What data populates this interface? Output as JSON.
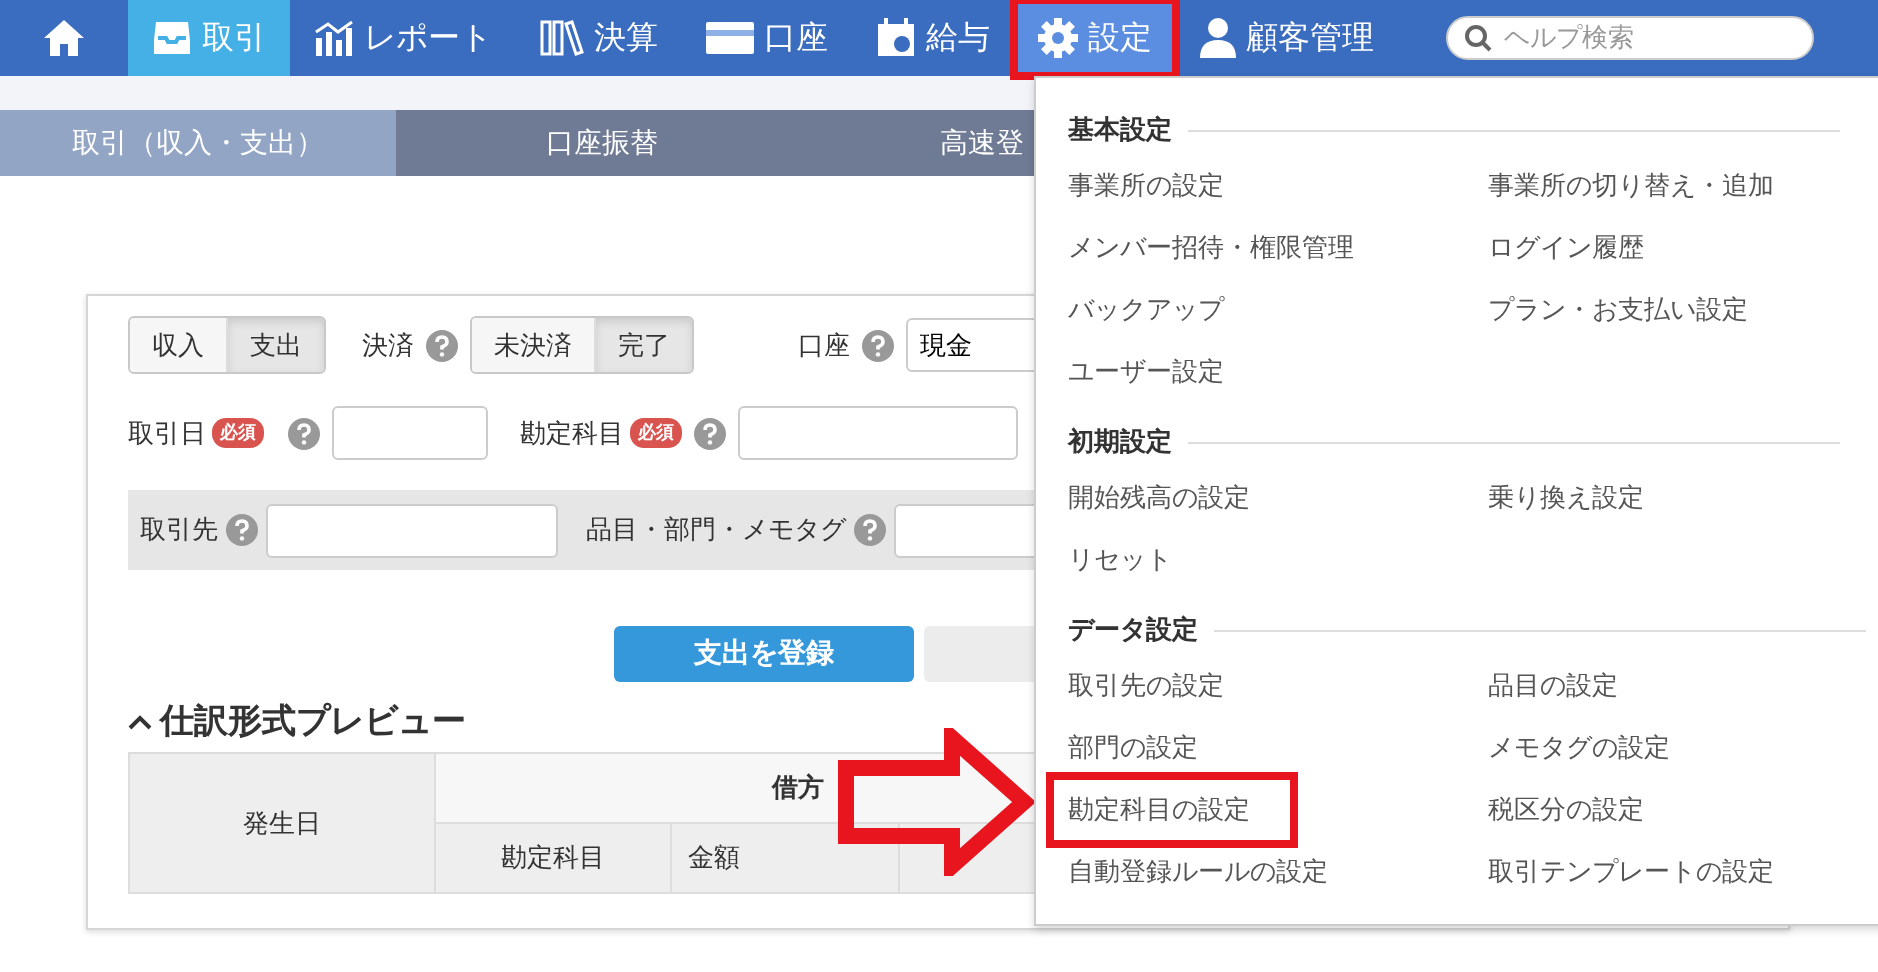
{
  "nav": {
    "items": [
      {
        "label": "取引",
        "selected": true,
        "highlighted": false
      },
      {
        "label": "レポート",
        "selected": false,
        "highlighted": false
      },
      {
        "label": "決算",
        "selected": false,
        "highlighted": false
      },
      {
        "label": "口座",
        "selected": false,
        "highlighted": false
      },
      {
        "label": "給与",
        "selected": false,
        "highlighted": false
      },
      {
        "label": "設定",
        "selected": false,
        "highlighted": true,
        "open": true
      },
      {
        "label": "顧客管理",
        "selected": false,
        "highlighted": false
      }
    ],
    "search": {
      "placeholder": "ヘルプ検索"
    }
  },
  "subtabs": [
    {
      "label": "取引（収入・支出）",
      "selected": true
    },
    {
      "label": "口座振替",
      "selected": false
    },
    {
      "label": "高速登",
      "selected": false
    }
  ],
  "form": {
    "type_toggle": [
      {
        "label": "収入",
        "selected": false
      },
      {
        "label": "支出",
        "selected": true
      }
    ],
    "settlement": {
      "label": "決済",
      "options": [
        {
          "label": "未決済",
          "selected": false
        },
        {
          "label": "完了",
          "selected": true
        }
      ]
    },
    "account": {
      "label": "口座",
      "value": "現金"
    },
    "date": {
      "label": "取引日",
      "badge": "必須"
    },
    "category": {
      "label": "勘定科目",
      "badge": "必須"
    },
    "partner": {
      "label": "取引先"
    },
    "tags": {
      "label": "品目・部門・メモタグ"
    },
    "submit_button": "支出を登録",
    "preview": {
      "title": "仕訳形式プレビュー",
      "expanded": true,
      "date_column": "発生日",
      "debit_column": "借方",
      "debit_subcolumns": [
        "勘定科目",
        "金額"
      ]
    }
  },
  "settings_menu": {
    "sections": [
      {
        "title": "基本設定",
        "items": [
          {
            "label": "事業所の設定",
            "highlighted": false
          },
          {
            "label": "事業所の切り替え・追加",
            "highlighted": false
          },
          {
            "label": "メンバー招待・権限管理",
            "highlighted": false
          },
          {
            "label": "ログイン履歴",
            "highlighted": false
          },
          {
            "label": "バックアップ",
            "highlighted": false
          },
          {
            "label": "プラン・お支払い設定",
            "highlighted": false
          },
          {
            "label": "ユーザー設定",
            "highlighted": false
          }
        ]
      },
      {
        "title": "初期設定",
        "items": [
          {
            "label": "開始残高の設定",
            "highlighted": false
          },
          {
            "label": "乗り換え設定",
            "highlighted": false
          },
          {
            "label": "リセット",
            "highlighted": false
          }
        ]
      },
      {
        "title": "データ設定",
        "items": [
          {
            "label": "取引先の設定",
            "highlighted": false
          },
          {
            "label": "品目の設定",
            "highlighted": false
          },
          {
            "label": "部門の設定",
            "highlighted": false
          },
          {
            "label": "メモタグの設定",
            "highlighted": false
          },
          {
            "label": "勘定科目の設定",
            "highlighted": true
          },
          {
            "label": "税区分の設定",
            "highlighted": false
          },
          {
            "label": "自動登録ルールの設定",
            "highlighted": false
          },
          {
            "label": "取引テンプレートの設定",
            "highlighted": false
          }
        ]
      }
    ]
  }
}
